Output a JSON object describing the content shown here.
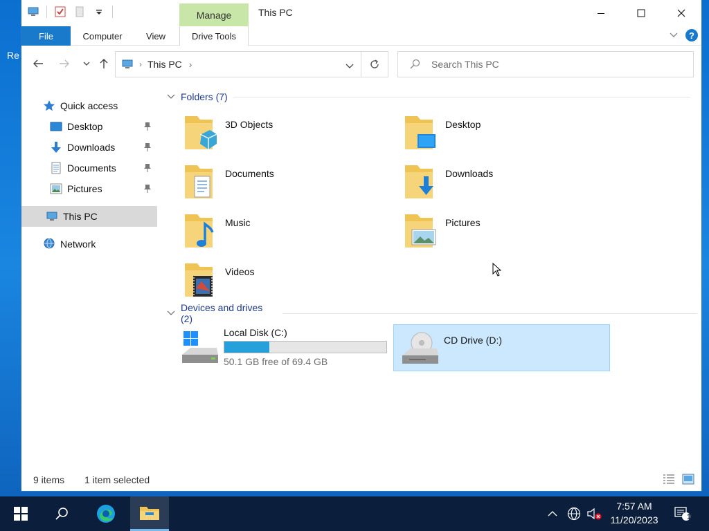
{
  "desktop": {
    "partial_icon_label": "Re"
  },
  "window": {
    "title": "This PC",
    "contextual_tab": "Manage",
    "ribbon_tabs": [
      {
        "label": "File"
      },
      {
        "label": "Computer"
      },
      {
        "label": "View"
      },
      {
        "label": "Drive Tools"
      }
    ]
  },
  "address": {
    "path": [
      "This PC"
    ]
  },
  "search": {
    "placeholder": "Search This PC"
  },
  "navpane": {
    "quick_access": "Quick access",
    "pinned": [
      {
        "label": "Desktop",
        "icon": "desktop-icon"
      },
      {
        "label": "Downloads",
        "icon": "downloads-icon"
      },
      {
        "label": "Documents",
        "icon": "documents-icon"
      },
      {
        "label": "Pictures",
        "icon": "pictures-icon"
      }
    ],
    "this_pc": "This PC",
    "network": "Network"
  },
  "content": {
    "folders_header": "Folders (7)",
    "folders": [
      {
        "label": "3D Objects"
      },
      {
        "label": "Desktop"
      },
      {
        "label": "Documents"
      },
      {
        "label": "Downloads"
      },
      {
        "label": "Music"
      },
      {
        "label": "Pictures"
      },
      {
        "label": "Videos"
      }
    ],
    "devices_header": "Devices and drives (2)",
    "drives": [
      {
        "label": "Local Disk (C:)",
        "free_text": "50.1 GB free of 69.4 GB",
        "used_fraction": 0.278
      },
      {
        "label": "CD Drive (D:)"
      }
    ]
  },
  "status": {
    "items": "9 items",
    "selected": "1 item selected"
  },
  "taskbar": {
    "time": "7:57 AM",
    "date": "11/20/2023",
    "notification_count": "1"
  },
  "colors": {
    "accent": "#1979ca",
    "manage_tab": "#c8e6a8",
    "selection": "#cce8ff",
    "drive_fill": "#26a0da",
    "taskbar": "#0b1e3b"
  }
}
